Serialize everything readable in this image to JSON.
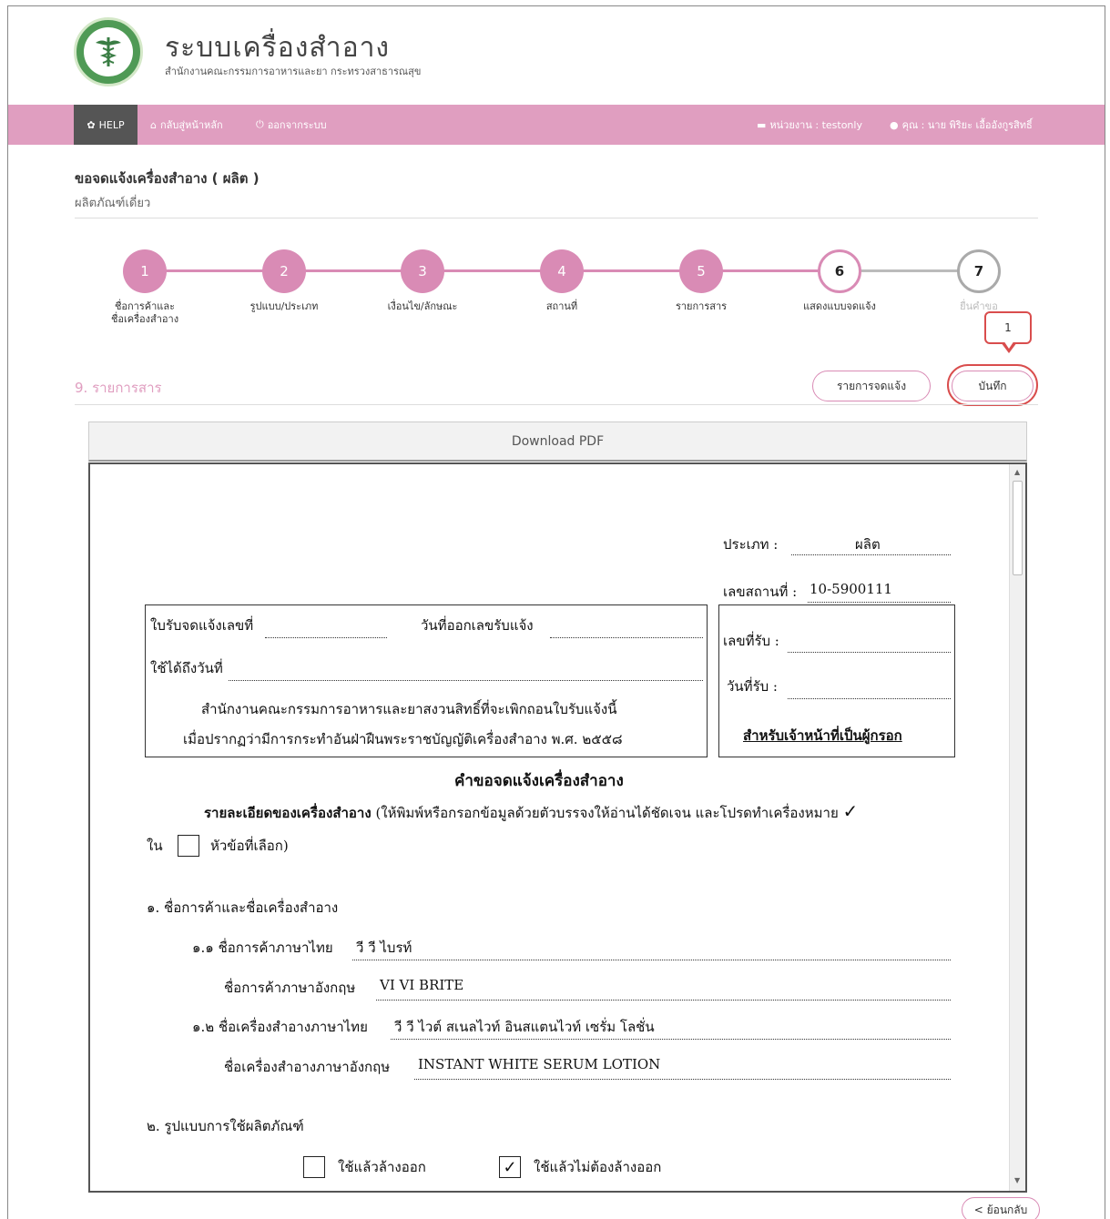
{
  "header": {
    "title": "ระบบเครื่องสำอาง",
    "subtitle": "สำนักงานคณะกรรมการอาหารและยา กระทรวงสาธารณสุข"
  },
  "nav": {
    "help": "HELP",
    "home": "กลับสู่หน้าหลัก",
    "logout": "ออกจากระบบ",
    "unit": "หน่วยงาน : testonly",
    "user": "คุณ : นาย พิริยะ เอื้ออังกูรสิทธิ์"
  },
  "page": {
    "title": "ขอจดแจ้งเครื่องสำอาง ( ผลิต )",
    "subtitle": "ผลิตภัณฑ์เดี่ยว"
  },
  "stepper": [
    {
      "num": "1",
      "label": "ชื่อการค้าและ\nชื่อเครื่องสำอาง",
      "state": "done"
    },
    {
      "num": "2",
      "label": "รูปแบบ/ประเภท",
      "state": "done"
    },
    {
      "num": "3",
      "label": "เงื่อนไข/ลักษณะ",
      "state": "done"
    },
    {
      "num": "4",
      "label": "สถานที่",
      "state": "done"
    },
    {
      "num": "5",
      "label": "รายการสาร",
      "state": "done"
    },
    {
      "num": "6",
      "label": "แสดงแบบจดแจ้ง",
      "state": "current"
    },
    {
      "num": "7",
      "label": "ยื่นคำขอ",
      "state": "todo"
    }
  ],
  "callout": "1",
  "section": {
    "title": "9. รายการสาร",
    "list_button": "รายการจดแจ้ง",
    "save_button": "บันทึก"
  },
  "pdf_bar": "Download PDF",
  "doc": {
    "type_label": "ประเภท :",
    "type_value": "ผลิต",
    "place_label": "เลขสถานที่ :",
    "place_value": "10-5900111",
    "receipt_no": "ใบรับจดแจ้งเลขที่",
    "issue_date": "วันที่ออกเลขรับแจ้ง",
    "valid_until": "ใช้ได้ถึงวันที่",
    "notice_1": "สำนักงานคณะกรรมการอาหารและยาสงวนสิทธิ์ที่จะเพิกถอนใบรับแจ้งนี้",
    "notice_2": "เมื่อปรากฏว่ามีการกระทำอันฝ่าฝืนพระราชบัญญัติเครื่องสำอาง พ.ศ. ๒๕๕๘",
    "recv_no": "เลขที่รับ :",
    "recv_date": "วันที่รับ :",
    "officer": "สำหรับเจ้าหน้าที่เป็นผู้กรอก",
    "form_title": "คำขอจดแจ้งเครื่องสำอาง",
    "detail_bold": "รายละเอียดของเครื่องสำอาง",
    "detail_rest": "(ให้พิมพ์หรือกรอกข้อมูลด้วยตัวบรรจงให้อ่านได้ชัดเจน และโปรดทำเครื่องหมาย",
    "check_mark": "✓",
    "in_word": "ใน",
    "selected_topic": "หัวข้อที่เลือก)",
    "s1": "๑. ชื่อการค้าและชื่อเครื่องสำอาง",
    "s1_1_label": "๑.๑ ชื่อการค้าภาษาไทย",
    "s1_1_value": "วี วี ไบรท์",
    "s1_1en_label": "ชื่อการค้าภาษาอังกฤษ",
    "s1_1en_value": "VI VI BRITE",
    "s1_2_label": "๑.๒ ชื่อเครื่องสำอางภาษาไทย",
    "s1_2_value": "วี วี ไวต์ สเนลไวท์ อินสแตนไวท์ เซรั่ม โลชั่น",
    "s1_2en_label": "ชื่อเครื่องสำอางภาษาอังกฤษ",
    "s1_2en_value": "INSTANT WHITE SERUM LOTION",
    "s2": "๒. รูปแบบการใช้ผลิตภัณฑ์",
    "opt_rinse": "ใช้แล้วล้างออก",
    "opt_leave": "ใช้แล้วไม่ต้องล้างออก"
  },
  "back_button": "< ย้อนกลับ"
}
